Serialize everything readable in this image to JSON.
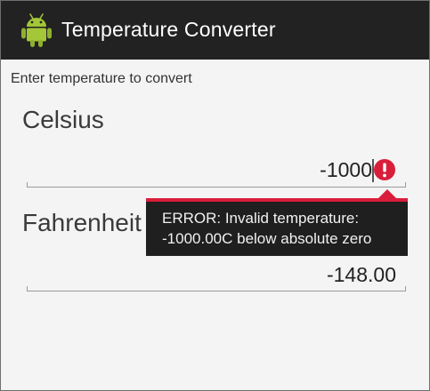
{
  "app": {
    "title": "Temperature Converter",
    "icon": "android-icon"
  },
  "form": {
    "prompt": "Enter temperature to convert",
    "celsius": {
      "label": "Celsius",
      "value": "-1000"
    },
    "fahrenheit": {
      "label": "Fahrenheit",
      "value": "-148.00"
    }
  },
  "error": {
    "line1": "ERROR: Invalid temperature:",
    "line2": "-1000.00C below absolute zero",
    "icon": "error-exclamation-icon",
    "color": "#d91e3b"
  },
  "colors": {
    "actionbar": "#222222",
    "background": "#f4f4f4"
  }
}
